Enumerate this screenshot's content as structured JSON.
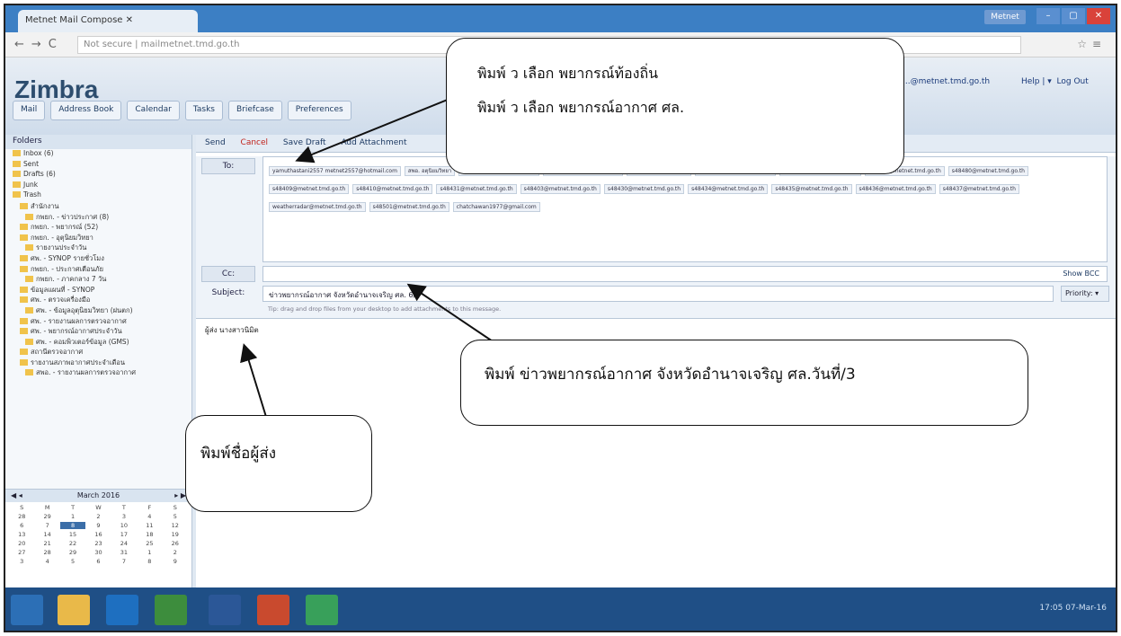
{
  "browser": {
    "tab_title": "Metnet Mail Compose",
    "url": "Not secure | mailmetnet.tmd.go.th",
    "user_badge": "Metnet"
  },
  "header": {
    "logo": "Zimbra",
    "user_address": "...@metnet.tmd.go.th",
    "help": "Help | ▾",
    "logout": "Log Out",
    "app_tabs": [
      "Mail",
      "Address Book",
      "Calendar",
      "Tasks",
      "Briefcase",
      "Preferences"
    ]
  },
  "sidebar": {
    "title": "Folders",
    "folders": [
      "Inbox (6)",
      "Sent",
      "Drafts (6)",
      "Junk",
      "Trash",
      "สำนักงาน",
      "กพยก. - ข่าวประกาศ (8)",
      "กพยก. - พยากรณ์ (52)",
      "กพยก. - อุตุนิยมวิทยา",
      "รายงานประจำวัน",
      "ศพ. - SYNOP รายชั่วโมง",
      "กพยก. - ประกาศเตือนภัย",
      "กพยก. - ภาคกลาง 7 วัน",
      "ข้อมูลแผนที่ - SYNOP",
      "ศพ. - ตรวจเครื่องมือ",
      "ศพ. - ข้อมูลอุตุนิยมวิทยา (ฝนตก)",
      "ศพ. - รายงานผลการตรวจอากาศ",
      "ศพ. - พยากรณ์อากาศประจำวัน",
      "ศพ. - คอมพิวเตอร์ข้อมูล (GMS)",
      "สถานีตรวจอากาศ",
      "รายงานสภาพอากาศประจำเดือน",
      "สพอ. - รายงานผลการตรวจอากาศ"
    ],
    "calendar": {
      "month": "March 2016",
      "days": [
        "S",
        "M",
        "T",
        "W",
        "T",
        "F",
        "S",
        "28",
        "29",
        "1",
        "2",
        "3",
        "4",
        "5",
        "6",
        "7",
        "8",
        "9",
        "10",
        "11",
        "12",
        "13",
        "14",
        "15",
        "16",
        "17",
        "18",
        "19",
        "20",
        "21",
        "22",
        "23",
        "24",
        "25",
        "26",
        "27",
        "28",
        "29",
        "30",
        "31",
        "1",
        "2",
        "3",
        "4",
        "5",
        "6",
        "7",
        "8",
        "9"
      ]
    }
  },
  "compose": {
    "toolbar": [
      "Send",
      "Cancel",
      "Save Draft",
      "Add Attachment"
    ],
    "to_label": "To:",
    "to_recipients": [
      "yamuthastani2557 metnet2557@hotmail.com",
      "สพอ. อตุนิยมวิทยา",
      "ssl2557@metnet.tmd.go.th",
      "TMDAXDUL_@hotmail.com",
      "P1755@hotmail.co.th",
      "ssl2003@metnet.tmd.go.th",
      "ssl2003@metnet.tmd.go.th",
      "s48301@metnet.tmd.go.th",
      "s48480@metnet.tmd.go.th",
      "s48409@metnet.tmd.go.th",
      "s48410@metnet.tmd.go.th",
      "s48431@metnet.tmd.go.th",
      "s48403@metnet.tmd.go.th",
      "s48430@metnet.tmd.go.th",
      "s48434@metnet.tmd.go.th",
      "s48435@metnet.tmd.go.th",
      "s48436@metnet.tmd.go.th",
      "s48437@metnet.tmd.go.th",
      "weatherradar@metnet.tmd.go.th",
      "s48501@metnet.tmd.go.th",
      "chatchawan1977@gmail.com"
    ],
    "cc_label": "Cc:",
    "show_bcc": "Show BCC",
    "subject_label": "Subject:",
    "subject_value": "ข่าวพยากรณ์อากาศ จังหวัดอำนาจเจริญ ศล. 6/3",
    "priority_label": "Priority:",
    "hint": "Tip: drag and drop files from your desktop to add attachments to this message.",
    "body_text": "ผู้ส่ง นางสาวนิมิต"
  },
  "callouts": {
    "top_line1": "พิมพ์ ว เลือก พยากรณ์ท้องถิ่น",
    "top_line2": "พิมพ์ ว เลือก พยากรณ์อากาศ ศล.",
    "middle": "พิมพ์ ข่าวพยากรณ์อากาศ จังหวัดอำนาจเจริญ  ศล.วันที่/3",
    "bottom": "พิมพ์ชื่อผู้ส่ง"
  },
  "taskbar": {
    "time": "17:05",
    "date": "07-Mar-16"
  }
}
